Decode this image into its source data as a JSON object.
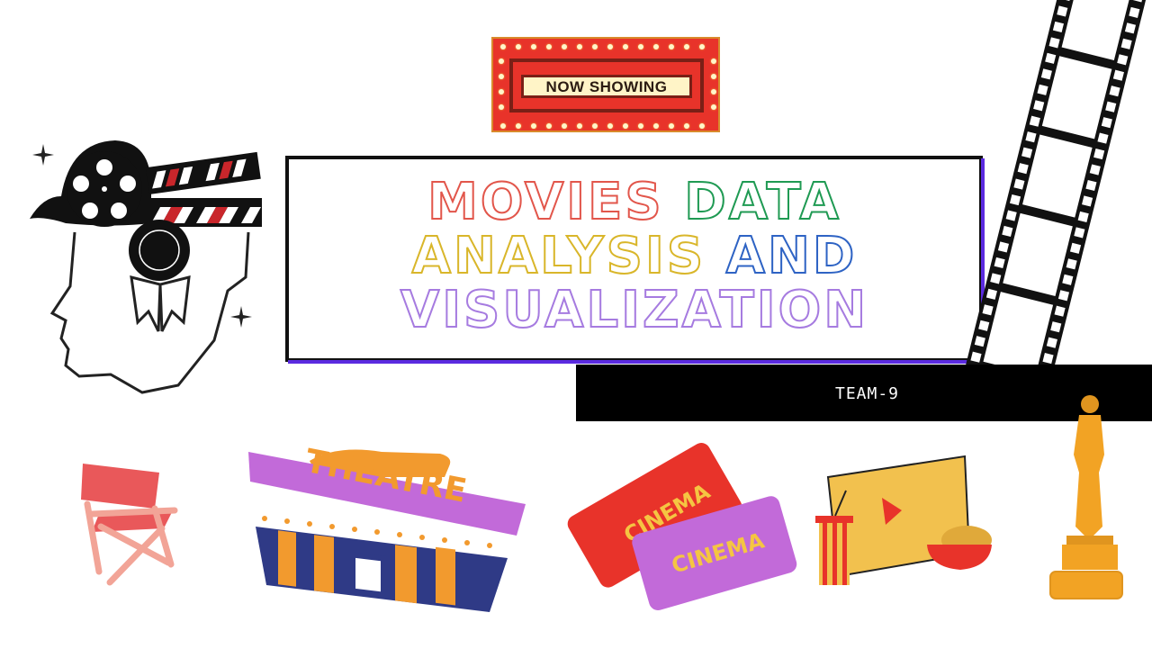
{
  "marquee": {
    "label": "NOW SHOWING"
  },
  "title": {
    "line1": [
      "MOVIES",
      "DATA"
    ],
    "line2": [
      "ANALYSIS",
      "AND"
    ],
    "line3": [
      "VISUALIZATION"
    ]
  },
  "team": {
    "label": "TEAM-9"
  },
  "illustrations": {
    "theatre_sign": "THEATRE",
    "ticket_front": "CINEMA",
    "ticket_back": "CINEMA"
  },
  "colors": {
    "movies": "#e2564b",
    "data": "#1f9a53",
    "analysis": "#d9b62a",
    "and": "#2e63c4",
    "visualization": "#a67be0",
    "accent": "#5b2be0"
  },
  "icons": [
    "head-film-reel-icon",
    "clapperboard-icon",
    "award-rosette-icon",
    "sparkle-icon",
    "film-strip-icon",
    "directors-chair-icon",
    "theatre-building-icon",
    "cinema-tickets-icon",
    "video-screen-popcorn-icon",
    "oscar-statue-icon"
  ]
}
